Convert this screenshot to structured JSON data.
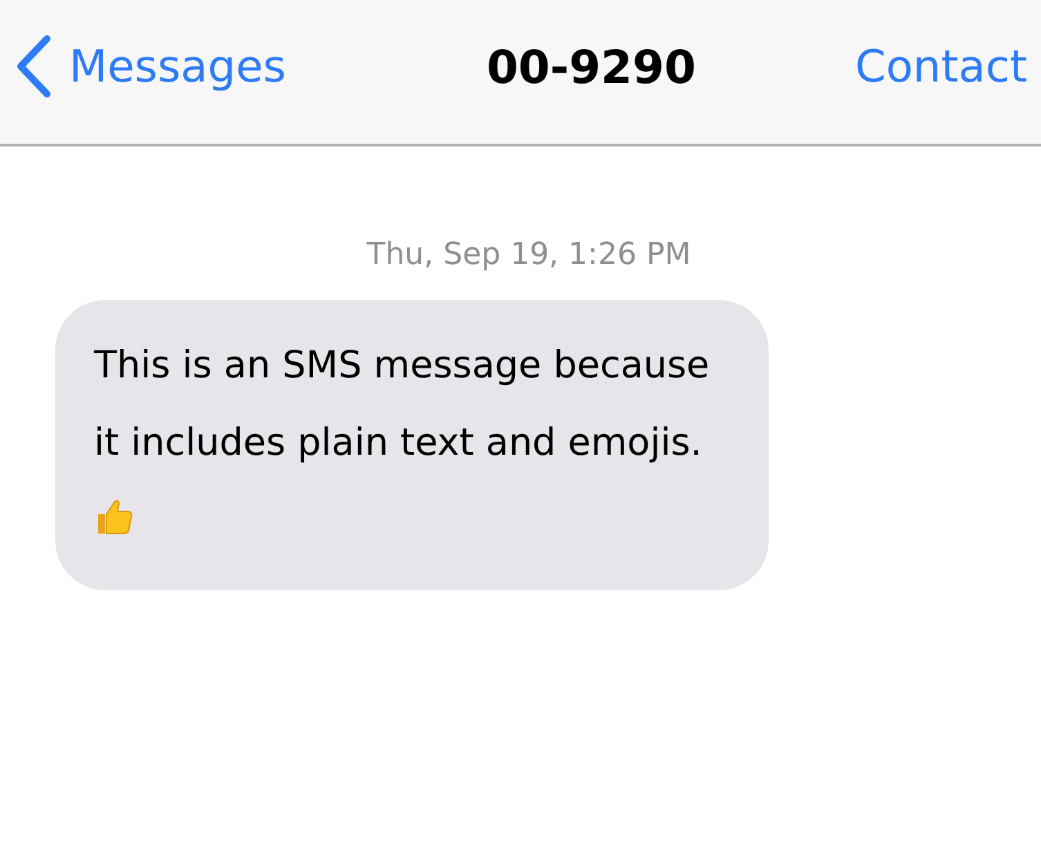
{
  "header": {
    "back_label": "Messages",
    "title": "00-9290",
    "action": "Contact"
  },
  "timestamp": "Thu, Sep 19, 1:26 PM",
  "messages": [
    {
      "kind": "received",
      "text": "This is an SMS message because it includes plain text and emojis."
    }
  ]
}
